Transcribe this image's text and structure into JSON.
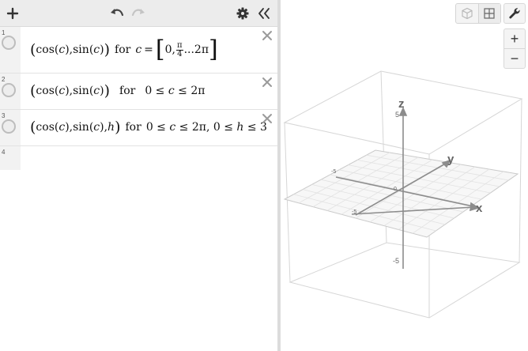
{
  "toolbar": {
    "add_icon": "plus-icon",
    "undo_icon": "undo-arrow-icon",
    "redo_icon": "redo-arrow-icon",
    "settings_icon": "gear-icon",
    "collapse_icon": "double-chevron-left-icon"
  },
  "expressions": [
    {
      "number": "1",
      "parts": {
        "lparen": "(",
        "cos": "cos",
        "c1": "c",
        "sin": "sin",
        "c2": "c",
        "rparen": ")",
        "for": "for",
        "var": "c",
        "eq": "=",
        "zero": "0,",
        "pi_num": "π",
        "pi_den": "4",
        "dots": "...2π"
      }
    },
    {
      "number": "2",
      "parts": {
        "lparen": "(",
        "cos": "cos",
        "c1": "c",
        "sin": "sin",
        "c2": "c",
        "rparen": ")",
        "for": "for",
        "range": "0 ≤ ",
        "var": "c",
        "range_end": " ≤ 2π"
      }
    },
    {
      "number": "3",
      "parts": {
        "lparen": "(",
        "cos": "cos",
        "c1": "c",
        "sin": "sin",
        "c2": "c",
        "h": "h",
        "rparen": ")",
        "for": "for",
        "range_a": "0 ≤ ",
        "var_c": "c",
        "range_b": " ≤ 2π, 0 ≤ ",
        "var_h": "h",
        "range_c": " ≤ 3"
      }
    },
    {
      "number": "4"
    }
  ],
  "graph": {
    "axes": {
      "x_label": "x",
      "y_label": "y",
      "z_label": "z"
    },
    "ticks": {
      "z_top": "5",
      "z_bottom": "-5",
      "x_neg": "-5",
      "y_neg": "-5",
      "origin": "0"
    },
    "colors": {
      "axis": "#8c8c8c",
      "box": "#d4d4d4",
      "grid": "#e4e4e4"
    },
    "controls": {
      "cube_view_icon": "cube-icon",
      "grid_view_icon": "grid-icon",
      "wrench_icon": "wrench-icon",
      "zoom_in": "+",
      "zoom_out": "−"
    }
  }
}
